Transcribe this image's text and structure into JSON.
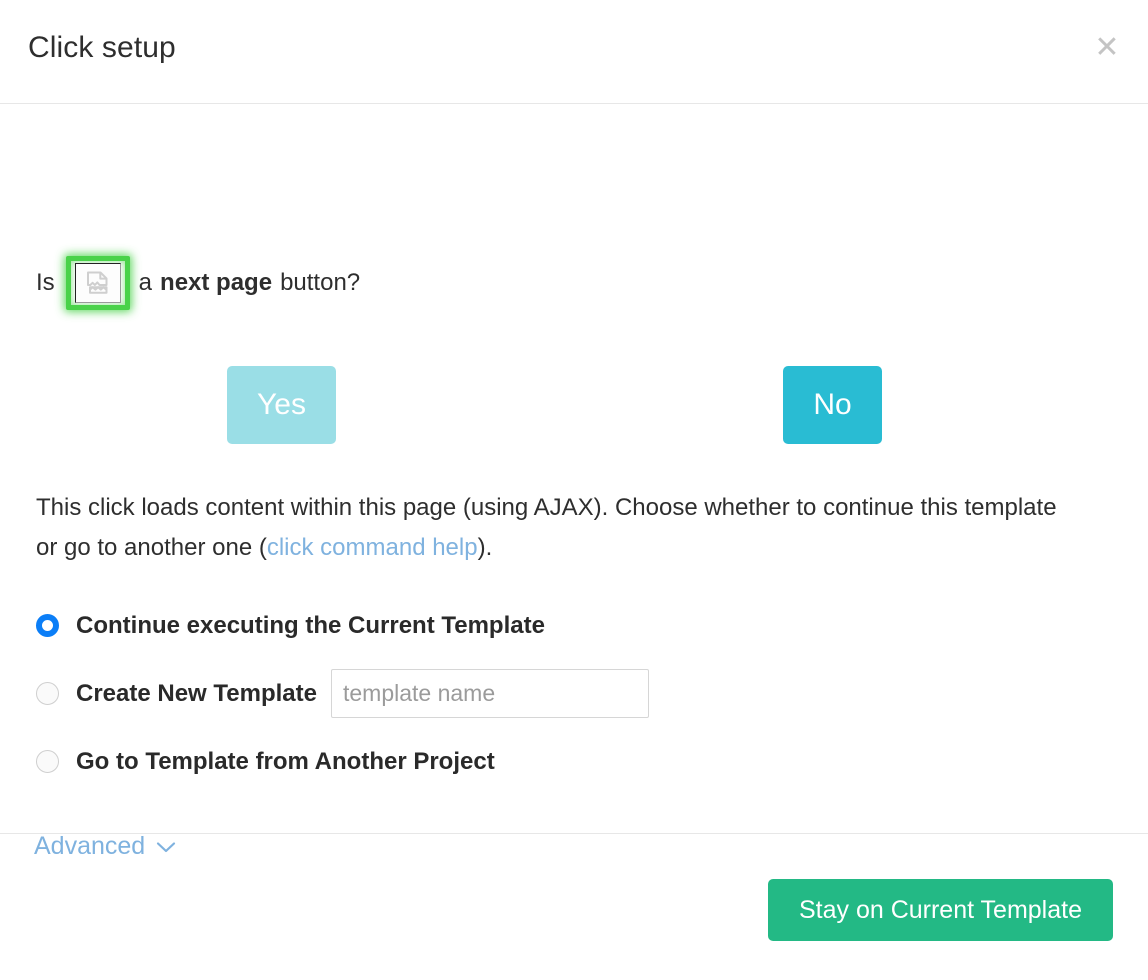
{
  "dialog": {
    "title": "Click setup",
    "close_label": "✕",
    "close_icon": "close-icon"
  },
  "question": {
    "prefix": "Is",
    "target_icon": "broken-image-icon",
    "middle": "a",
    "emphasis": "next page",
    "suffix": "button?",
    "highlight_color": "#4ad24a"
  },
  "choices": {
    "yes_label": "Yes",
    "yes_color": "#9adee6",
    "no_label": "No",
    "no_color": "#29bcd3"
  },
  "explanation": {
    "part1": "This click loads content within this page (using AJAX). Choose whether to continue this template or go to another one (",
    "link_text": "click command help",
    "link_color": "#7fb2df",
    "part2": ")."
  },
  "options": [
    {
      "label": "Continue executing the Current Template",
      "selected": true,
      "has_input": false
    },
    {
      "label": "Create New Template",
      "selected": false,
      "has_input": true,
      "input_value": "",
      "input_placeholder": "template name"
    },
    {
      "label": "Go to Template from Another Project",
      "selected": false,
      "has_input": false
    }
  ],
  "advanced": {
    "label": "Advanced",
    "chevron_icon": "chevron-down-icon"
  },
  "footer": {
    "primary_label": "Stay on Current Template",
    "primary_color": "#23b985"
  }
}
